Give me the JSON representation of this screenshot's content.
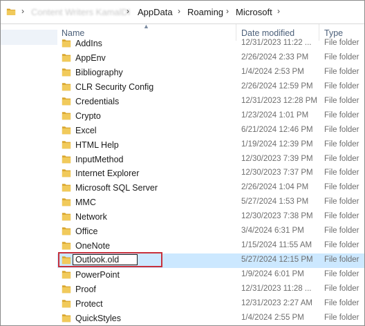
{
  "address_bar": {
    "crumbs": [
      {
        "label": "Content Writers KamalDI",
        "blurred": true
      },
      {
        "label": "AppData",
        "blurred": false
      },
      {
        "label": "Roaming",
        "blurred": false
      },
      {
        "label": "Microsoft",
        "blurred": false
      }
    ],
    "separator": "›"
  },
  "columns": {
    "name": "Name",
    "date_modified": "Date modified",
    "type": "Type"
  },
  "rows": [
    {
      "name": "AddIns",
      "date": "12/31/2023 11:22 ...",
      "type": "File folder"
    },
    {
      "name": "AppEnv",
      "date": "2/26/2024 2:33 PM",
      "type": "File folder"
    },
    {
      "name": "Bibliography",
      "date": "1/4/2024 2:53 PM",
      "type": "File folder"
    },
    {
      "name": "CLR Security Config",
      "date": "2/26/2024 12:59 PM",
      "type": "File folder"
    },
    {
      "name": "Credentials",
      "date": "12/31/2023 12:28 PM",
      "type": "File folder"
    },
    {
      "name": "Crypto",
      "date": "1/23/2024 1:01 PM",
      "type": "File folder"
    },
    {
      "name": "Excel",
      "date": "6/21/2024 12:46 PM",
      "type": "File folder"
    },
    {
      "name": "HTML Help",
      "date": "1/19/2024 12:39 PM",
      "type": "File folder"
    },
    {
      "name": "InputMethod",
      "date": "12/30/2023 7:39 PM",
      "type": "File folder"
    },
    {
      "name": "Internet Explorer",
      "date": "12/30/2023 7:37 PM",
      "type": "File folder"
    },
    {
      "name": "Microsoft SQL Server",
      "date": "2/26/2024 1:04 PM",
      "type": "File folder"
    },
    {
      "name": "MMC",
      "date": "5/27/2024 1:53 PM",
      "type": "File folder"
    },
    {
      "name": "Network",
      "date": "12/30/2023 7:38 PM",
      "type": "File folder"
    },
    {
      "name": "Office",
      "date": "3/4/2024 6:31 PM",
      "type": "File folder"
    },
    {
      "name": "OneNote",
      "date": "1/15/2024 11:55 AM",
      "type": "File folder"
    },
    {
      "name": "Outlook.old",
      "date": "5/27/2024 12:15 PM",
      "type": "File folder",
      "selected": true,
      "renaming": true
    },
    {
      "name": "PowerPoint",
      "date": "1/9/2024 6:01 PM",
      "type": "File folder"
    },
    {
      "name": "Proof",
      "date": "12/31/2023 11:28 ...",
      "type": "File folder"
    },
    {
      "name": "Protect",
      "date": "12/31/2023 2:27 AM",
      "type": "File folder"
    },
    {
      "name": "QuickStyles",
      "date": "1/4/2024 2:55 PM",
      "type": "File folder"
    }
  ],
  "colors": {
    "selection": "#cce8ff",
    "highlight_outline": "#c8303a",
    "folder_yellow": "#e8bd46",
    "header_text": "#4c607a"
  },
  "icons": {
    "folder": "folder-icon",
    "sort": "sort-up-icon",
    "separator": "chevron-right-icon"
  }
}
